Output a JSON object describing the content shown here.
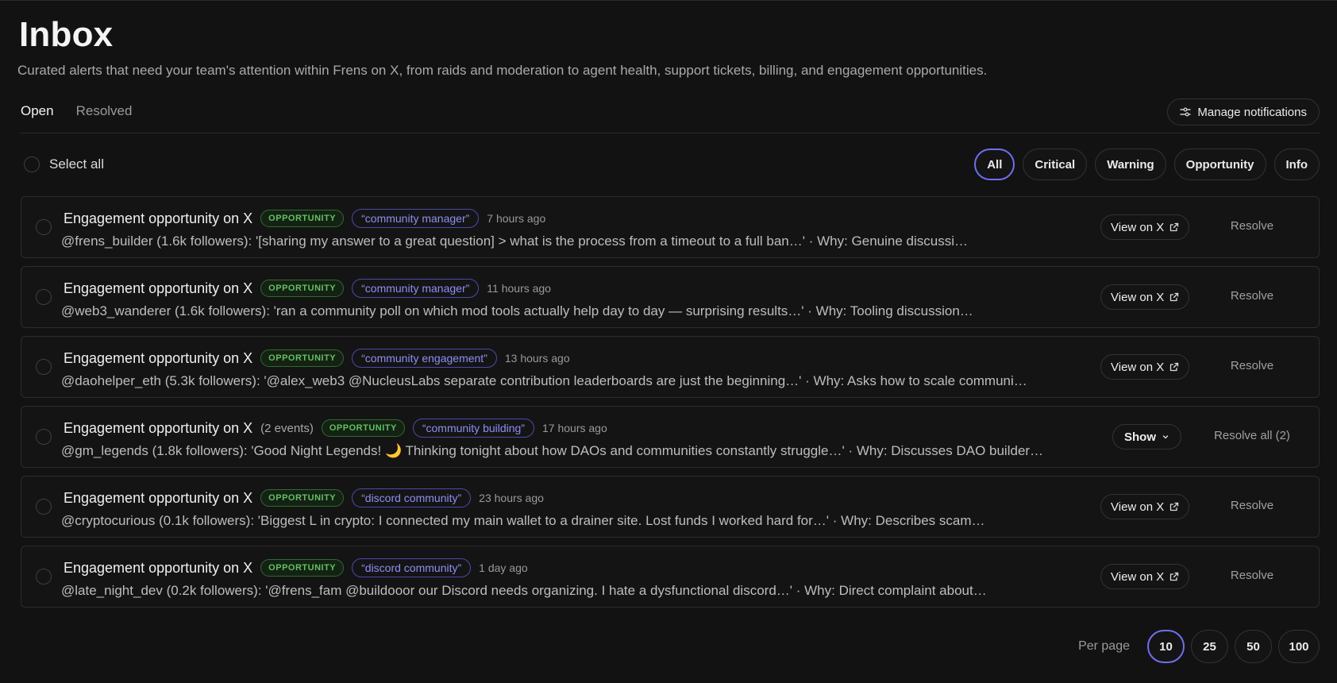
{
  "header": {
    "title": "Inbox",
    "subtitle": "Curated alerts that need your team's attention within Frens on X, from raids and moderation to agent health, support tickets, billing, and engagement opportunities."
  },
  "tabs": [
    {
      "label": "Open",
      "active": true
    },
    {
      "label": "Resolved",
      "active": false
    }
  ],
  "manage_notifications": {
    "label": "Manage notifications",
    "icon": "sliders-icon"
  },
  "select_all_label": "Select all",
  "filters": [
    {
      "label": "All",
      "active": true
    },
    {
      "label": "Critical",
      "active": false
    },
    {
      "label": "Warning",
      "active": false
    },
    {
      "label": "Opportunity",
      "active": false
    },
    {
      "label": "Info",
      "active": false
    }
  ],
  "alerts": [
    {
      "title": "Engagement opportunity on X",
      "badge": "OPPORTUNITY",
      "keyword": "“community manager”",
      "time": "7 hours ago",
      "body": "@frens_builder (1.6k followers): '[sharing my answer to a great question] > what is the process from a timeout to a full ban…' · Why: Genuine discussi…",
      "action": "View on X",
      "resolve": "Resolve"
    },
    {
      "title": "Engagement opportunity on X",
      "badge": "OPPORTUNITY",
      "keyword": "“community manager”",
      "time": "11 hours ago",
      "body": "@web3_wanderer (1.6k followers): 'ran a community poll on which mod tools actually help day to day — surprising results…' · Why: Tooling discussion…",
      "action": "View on X",
      "resolve": "Resolve"
    },
    {
      "title": "Engagement opportunity on X",
      "badge": "OPPORTUNITY",
      "keyword": "“community engagement”",
      "time": "13 hours ago",
      "body": "@daohelper_eth (5.3k followers): '@alex_web3 @NucleusLabs separate contribution leaderboards are just the beginning…' · Why: Asks how to scale communi…",
      "action": "View on X",
      "resolve": "Resolve"
    },
    {
      "title": "Engagement opportunity on X",
      "events": "(2 events)",
      "badge": "OPPORTUNITY",
      "keyword": "“community building”",
      "time": "17 hours ago",
      "body": "@gm_legends (1.8k followers): 'Good Night Legends! 🌙 Thinking tonight about how DAOs and communities constantly struggle…' · Why: Discusses DAO builder…",
      "action": "Show",
      "resolve": "Resolve all (2)"
    },
    {
      "title": "Engagement opportunity on X",
      "badge": "OPPORTUNITY",
      "keyword": "“discord community”",
      "time": "23 hours ago",
      "body": "@cryptocurious (0.1k followers): 'Biggest L in crypto: I connected my main wallet to a drainer site. Lost funds I worked hard for…' · Why: Describes scam…",
      "action": "View on X",
      "resolve": "Resolve"
    },
    {
      "title": "Engagement opportunity on X",
      "badge": "OPPORTUNITY",
      "keyword": "“discord community”",
      "time": "1 day ago",
      "body": "@late_night_dev (0.2k followers): '@frens_fam @buildooor our Discord needs organizing. I hate a dysfunctional discord…' · Why: Direct complaint about…",
      "action": "View on X",
      "resolve": "Resolve"
    }
  ],
  "pagination": {
    "label": "Per page",
    "options": [
      "10",
      "25",
      "50",
      "100"
    ],
    "selected": "10"
  },
  "colors": {
    "background": "#121212",
    "accent": "#6f6ff2",
    "opportunity": "#5fc25f",
    "keyword": "#8e8ef6"
  }
}
